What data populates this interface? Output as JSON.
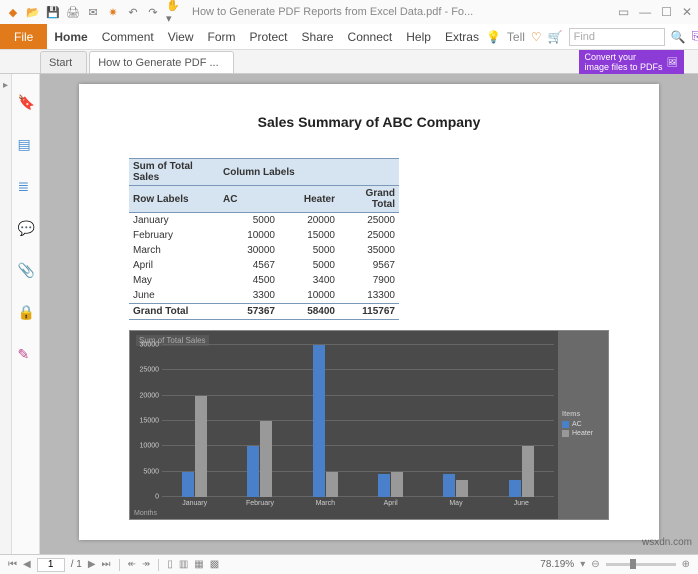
{
  "titlebar": {
    "title": "How to Generate PDF Reports from Excel Data.pdf - Fo..."
  },
  "menu": {
    "file": "File",
    "items": [
      "Home",
      "Comment",
      "View",
      "Form",
      "Protect",
      "Share",
      "Connect",
      "Help",
      "Extras"
    ],
    "tell": "Tell",
    "search_placeholder": "Find"
  },
  "tabs": {
    "start": "Start",
    "doc": "How to Generate PDF ..."
  },
  "promo": {
    "line1": "Convert your",
    "line2": "image files to PDFs"
  },
  "doc": {
    "title": "Sales Summary of ABC Company",
    "header1a": "Sum of Total Sales",
    "header1b": "Column Labels",
    "header2a": "Row Labels",
    "col1": "AC",
    "col2": "Heater",
    "col3": "Grand Total",
    "rows": [
      {
        "label": "January",
        "ac": "5000",
        "heater": "20000",
        "total": "25000"
      },
      {
        "label": "February",
        "ac": "10000",
        "heater": "15000",
        "total": "25000"
      },
      {
        "label": "March",
        "ac": "30000",
        "heater": "5000",
        "total": "35000"
      },
      {
        "label": "April",
        "ac": "4567",
        "heater": "5000",
        "total": "9567"
      },
      {
        "label": "May",
        "ac": "4500",
        "heater": "3400",
        "total": "7900"
      },
      {
        "label": "June",
        "ac": "3300",
        "heater": "10000",
        "total": "13300"
      }
    ],
    "gt_label": "Grand Total",
    "gt_ac": "57367",
    "gt_heater": "58400",
    "gt_total": "115767"
  },
  "chart": {
    "title": "Sum of Total Sales",
    "x_title": "Months",
    "legend_title": "Items",
    "legend1": "AC",
    "legend2": "Heater",
    "ylabels": [
      "0",
      "5000",
      "10000",
      "15000",
      "20000",
      "25000",
      "30000"
    ]
  },
  "chart_data": {
    "type": "bar",
    "categories": [
      "January",
      "February",
      "March",
      "April",
      "May",
      "June"
    ],
    "series": [
      {
        "name": "AC",
        "values": [
          5000,
          10000,
          30000,
          4567,
          4500,
          3300
        ]
      },
      {
        "name": "Heater",
        "values": [
          20000,
          15000,
          5000,
          5000,
          3400,
          10000
        ]
      }
    ],
    "title": "Sum of Total Sales",
    "xlabel": "Months",
    "ylabel": "",
    "ylim": [
      0,
      30000
    ],
    "legend_title": "Items"
  },
  "status": {
    "page": "1",
    "pages": "/ 1",
    "zoom": "78.19%"
  },
  "watermark": "wsxdn.com"
}
